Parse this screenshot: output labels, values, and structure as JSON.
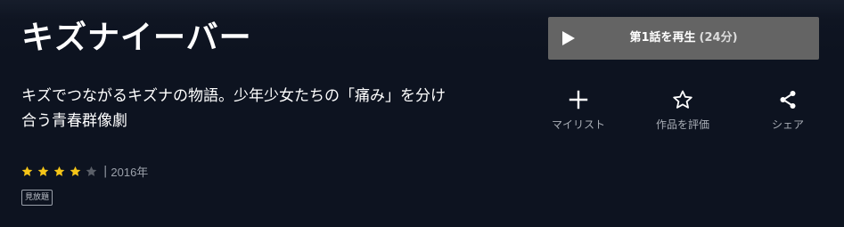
{
  "title": "キズナイーバー",
  "description": "キズでつながるキズナの物語。少年少女たちの「痛み」を分け合う青春群像劇",
  "rating": {
    "value": 4,
    "max": 5,
    "filled_color": "#f5c518",
    "empty_color": "#5a5f68"
  },
  "year": "2016年",
  "separator": "|",
  "badge": "見放題",
  "play_button": {
    "label": "第1話を再生",
    "duration": "(24分)",
    "icon": "play-icon"
  },
  "actions": [
    {
      "label": "マイリスト",
      "icon": "plus-icon"
    },
    {
      "label": "作品を評価",
      "icon": "star-outline-icon"
    },
    {
      "label": "シェア",
      "icon": "share-icon"
    }
  ]
}
